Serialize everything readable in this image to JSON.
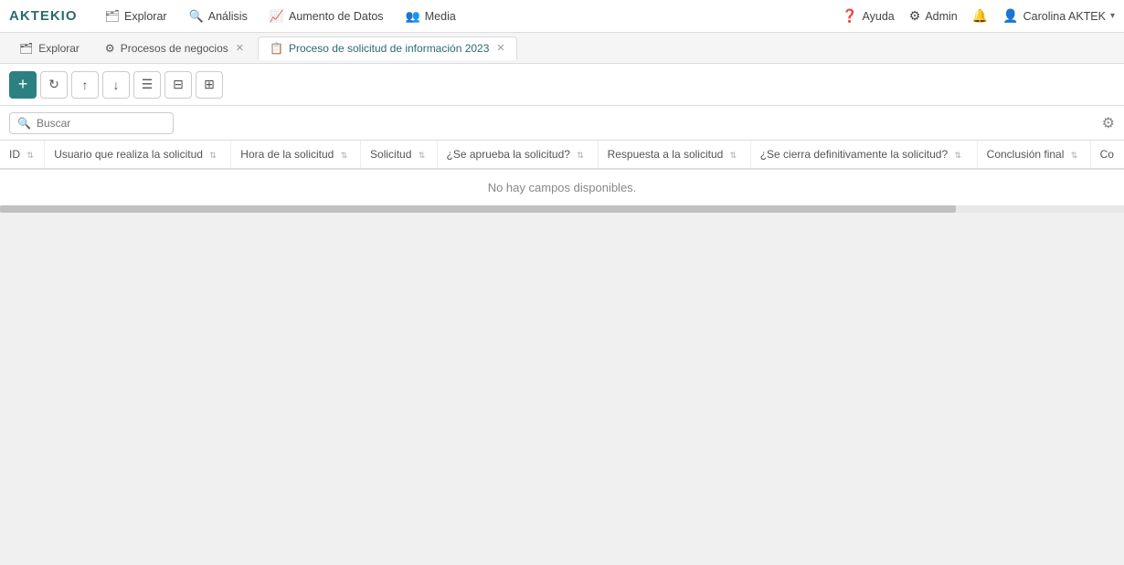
{
  "logo": {
    "text": "AKTEKIO"
  },
  "nav": {
    "items": [
      {
        "id": "explorar",
        "icon": "🗂",
        "label": "Explorar"
      },
      {
        "id": "analisis",
        "icon": "🔍",
        "label": "Análisis"
      },
      {
        "id": "aumento",
        "icon": "📈",
        "label": "Aumento de Datos"
      },
      {
        "id": "media",
        "icon": "👥",
        "label": "Media"
      }
    ]
  },
  "nav_right": {
    "help": "Ayuda",
    "admin": "Admin",
    "user": "Carolina AKTEK"
  },
  "tabs": [
    {
      "id": "explorar",
      "icon": "🗂",
      "label": "Explorar",
      "closable": false,
      "active": false
    },
    {
      "id": "procesos",
      "icon": "⚙",
      "label": "Procesos de negocios",
      "closable": true,
      "active": false
    },
    {
      "id": "proceso-solicitud",
      "icon": "📋",
      "label": "Proceso de solicitud de información 2023",
      "closable": true,
      "active": true
    }
  ],
  "toolbar": {
    "add_label": "+",
    "buttons": [
      {
        "id": "add",
        "icon": "+",
        "primary": true
      },
      {
        "id": "refresh",
        "icon": "↻"
      },
      {
        "id": "upload",
        "icon": "↑"
      },
      {
        "id": "download",
        "icon": "↓"
      },
      {
        "id": "list",
        "icon": "☰"
      },
      {
        "id": "filter",
        "icon": "⊟"
      },
      {
        "id": "grid",
        "icon": "⊞"
      }
    ]
  },
  "search": {
    "placeholder": "Buscar"
  },
  "table": {
    "columns": [
      {
        "id": "id",
        "label": "ID"
      },
      {
        "id": "usuario",
        "label": "Usuario que realiza la solicitud"
      },
      {
        "id": "hora",
        "label": "Hora de la solicitud"
      },
      {
        "id": "solicitud",
        "label": "Solicitud"
      },
      {
        "id": "aprueba",
        "label": "¿Se aprueba la solicitud?"
      },
      {
        "id": "respuesta",
        "label": "Respuesta a la solicitud"
      },
      {
        "id": "cierra",
        "label": "¿Se cierra definitivamente la solicitud?"
      },
      {
        "id": "conclusion",
        "label": "Conclusión final"
      },
      {
        "id": "col_extra",
        "label": "Co"
      }
    ],
    "empty_message": "No hay campos disponibles."
  }
}
